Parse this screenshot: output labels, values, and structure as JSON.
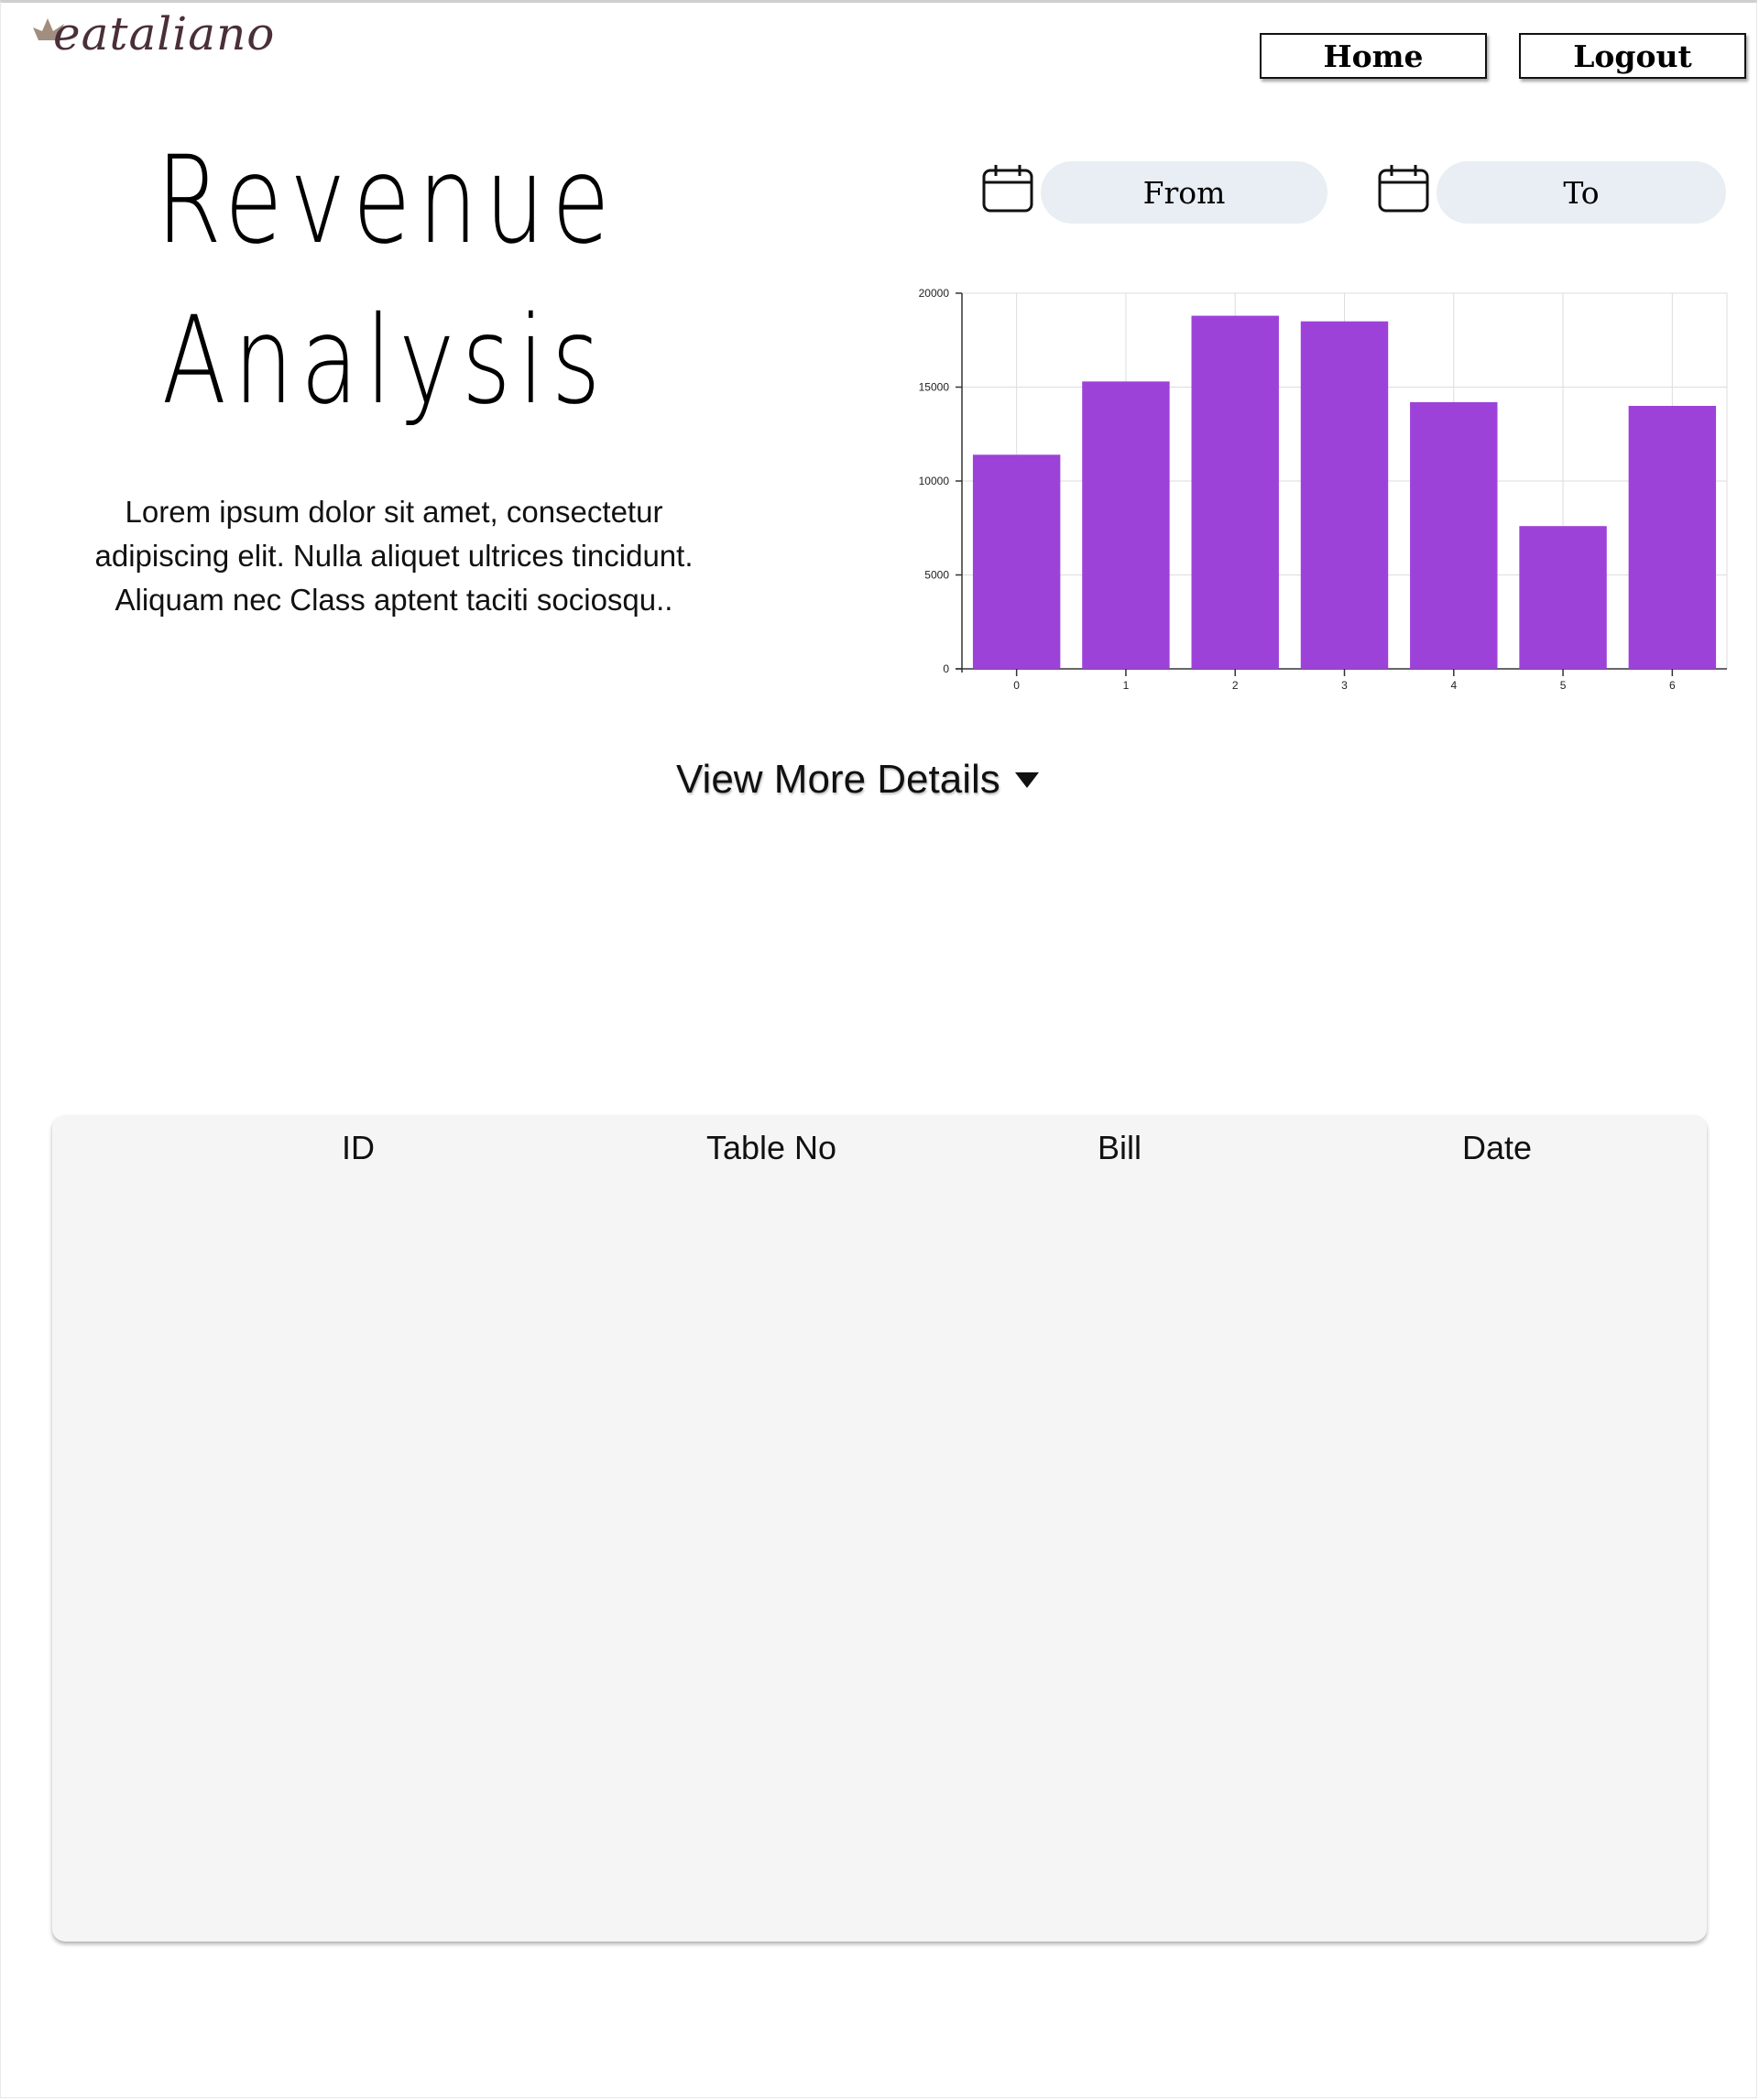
{
  "brand": {
    "name": "eataliano"
  },
  "nav": {
    "home_label": "Home",
    "logout_label": "Logout"
  },
  "page": {
    "title_line1": "Revenue",
    "title_line2": "Analysis",
    "intro": "Lorem ipsum dolor sit amet, consectetur adipiscing elit. Nulla aliquet ultrices tincidunt. Aliquam nec Class aptent taciti sociosqu.."
  },
  "filters": {
    "from_label": "From",
    "to_label": "To",
    "icon": "calendar-icon"
  },
  "details": {
    "toggle_label": "View More Details",
    "toggle_icon": "caret-down-icon"
  },
  "table": {
    "columns": [
      "ID",
      "Table No",
      "Bill",
      "Date"
    ],
    "rows": []
  },
  "colors": {
    "bar": "#9d42d9",
    "pill": "#e8eef3",
    "brand": "#4a2f38",
    "panel": "#f5f5f5"
  },
  "chart_data": {
    "type": "bar",
    "categories": [
      "0",
      "1",
      "2",
      "3",
      "4",
      "5",
      "6"
    ],
    "values": [
      11400,
      15300,
      18800,
      18500,
      14200,
      7600,
      14000
    ],
    "ylim": [
      0,
      20000
    ],
    "yticks": [
      "0",
      "5000",
      "10000",
      "15000",
      "20000"
    ],
    "grid": true,
    "legend": "none"
  }
}
